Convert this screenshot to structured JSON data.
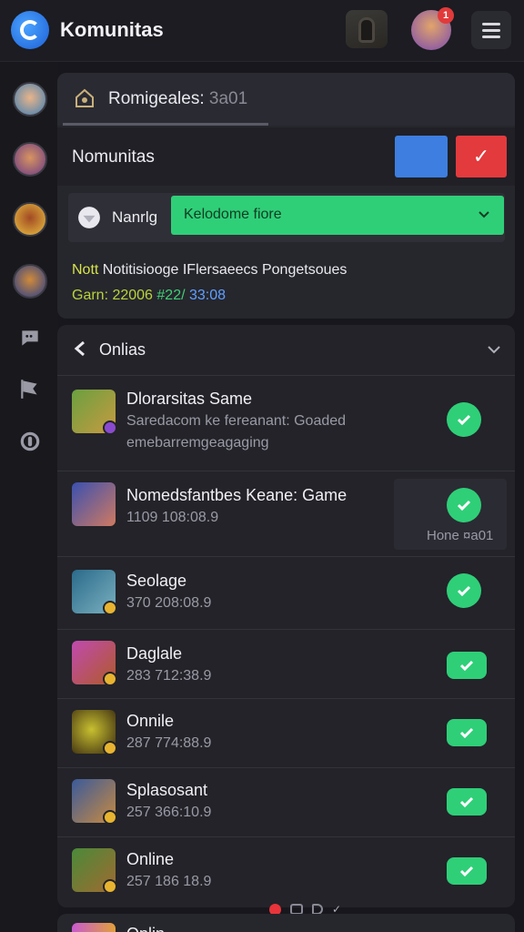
{
  "app": {
    "title": "Komunitas"
  },
  "topbar": {
    "notification_count": "1"
  },
  "panel1": {
    "header_title": "Romigeales:",
    "header_suffix": "3a01",
    "row_label": "Nomunitas",
    "select_label": "Nanrlg",
    "select_value": "Kelodome fiore",
    "note_line1_key": "Nott",
    "note_line1_rest": "Notitisiooge IFlersaeecs Pongetsoues",
    "note_line2_a": "Garn: 22006",
    "note_line2_b": "#22/",
    "note_line2_c": "33:08"
  },
  "panel2": {
    "header_title": "Onlias",
    "games": [
      {
        "title": "Dlorarsitas Same",
        "sub": "Saredacom ke fereanant: Goaded",
        "sub2": "emebarremgeagaging"
      },
      {
        "title": "Nomedsfantbes Keane: Game",
        "sub": "1109 108:08.9",
        "hover": "Hone ¤a01"
      },
      {
        "title": "Seolage",
        "sub": "370 208:08.9"
      },
      {
        "title": "Daglale",
        "sub": "283 712:38.9"
      },
      {
        "title": "Onnile",
        "sub": "287 774:88.9"
      },
      {
        "title": "Splasosant",
        "sub": "257 366:10.9"
      },
      {
        "title": "Online",
        "sub": "257 186 18.9"
      }
    ]
  },
  "panel3": {
    "title": "Onlin"
  },
  "colors": {
    "accent_green": "#2fcf78",
    "accent_blue": "#3d7ee0",
    "accent_red": "#e33a3d"
  }
}
